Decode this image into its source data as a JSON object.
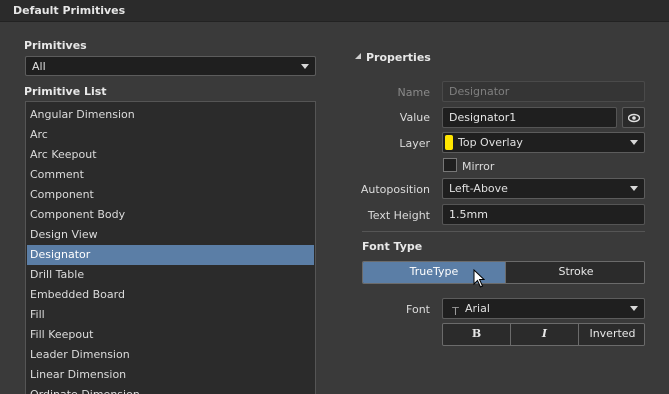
{
  "window": {
    "title": "Default Primitives"
  },
  "primitives": {
    "label": "Primitives",
    "selected": "All"
  },
  "primitive_list": {
    "label": "Primitive List",
    "items": [
      "Angular Dimension",
      "Arc",
      "Arc Keepout",
      "Comment",
      "Component",
      "Component Body",
      "Design View",
      "Designator",
      "Drill Table",
      "Embedded Board",
      "Fill",
      "Fill Keepout",
      "Leader Dimension",
      "Linear Dimension",
      "Ordinate Dimension"
    ],
    "selected_index": 7
  },
  "properties": {
    "header": "Properties",
    "name_label": "Name",
    "name_value": "Designator",
    "value_label": "Value",
    "value_value": "Designator1",
    "layer_label": "Layer",
    "layer_value": "Top Overlay",
    "layer_color": "#ffe600",
    "mirror_label": "Mirror",
    "mirror_checked": false,
    "autoposition_label": "Autoposition",
    "autoposition_value": "Left-Above",
    "text_height_label": "Text Height",
    "text_height_value": "1.5mm",
    "font_type_header": "Font Type",
    "font_type_options": [
      "TrueType",
      "Stroke"
    ],
    "font_type_selected": "TrueType",
    "font_label": "Font",
    "font_value": "Arial",
    "bold_label": "B",
    "italic_label": "I",
    "inverted_label": "Inverted"
  },
  "colors": {
    "accent": "#5b7ea6",
    "background": "#3a3a3a",
    "field_bg": "#1f1f1f"
  },
  "icons": {
    "visibility": "eye-icon",
    "font_type": "truetype-font-icon",
    "dropdown": "chevron-down-icon",
    "collapse": "collapse-triangle-icon"
  }
}
